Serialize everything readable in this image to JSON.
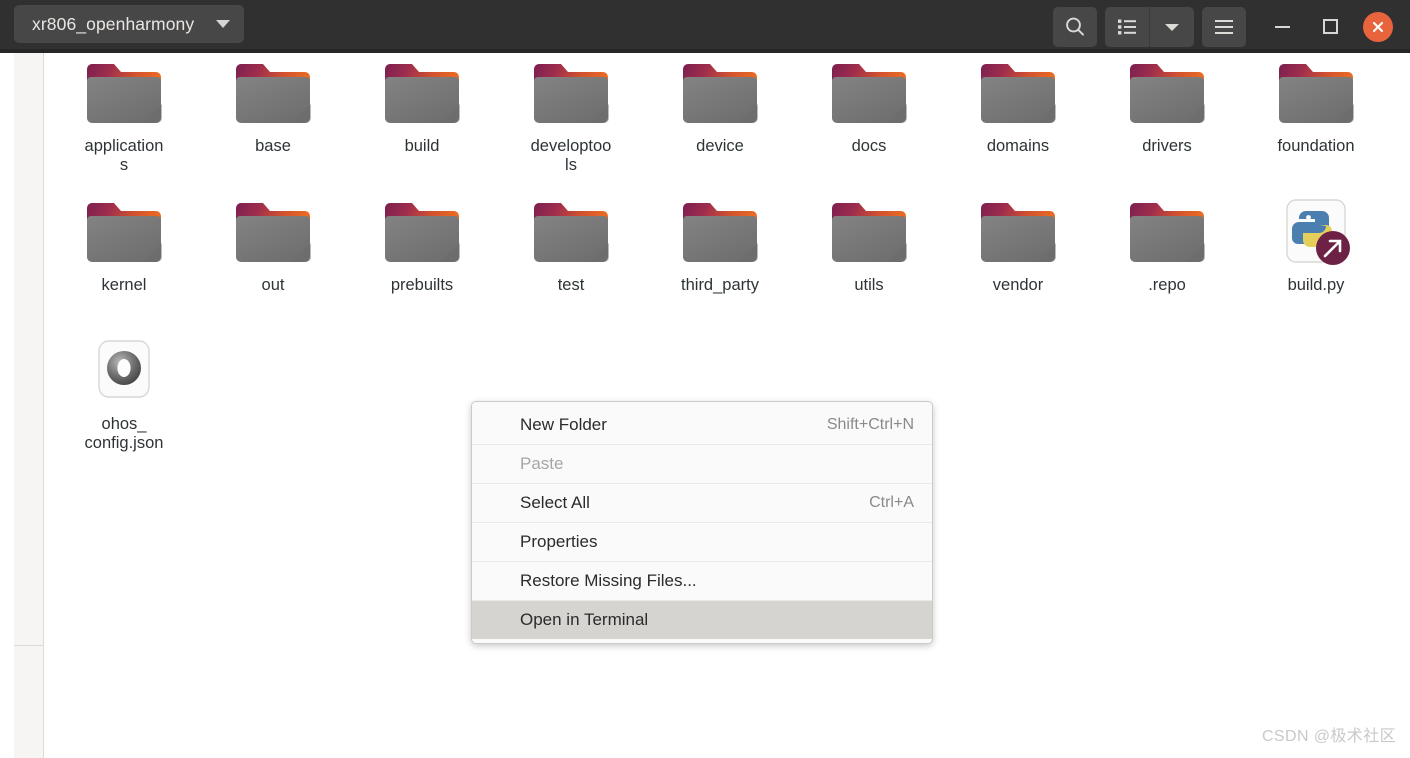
{
  "window": {
    "title": "xr806_openharmony",
    "accent_close": "#e8643c",
    "titlebar_bg": "#303030",
    "tab_bg": "#474747"
  },
  "titlebar": {
    "path_tab_label": "xr806_openharmony",
    "path_dropdown_icon": "chevron-down-icon",
    "search_icon": "search-icon",
    "list_view_icon": "list-view-icon",
    "view_dropdown_icon": "chevron-down-icon",
    "menu_icon": "hamburger-menu-icon",
    "minimize_icon": "minimize-icon",
    "maximize_icon": "maximize-icon",
    "close_icon": "close-icon"
  },
  "files": [
    {
      "name": "applications",
      "display": "application\ns",
      "type": "folder"
    },
    {
      "name": "base",
      "display": "base",
      "type": "folder"
    },
    {
      "name": "build",
      "display": "build",
      "type": "folder"
    },
    {
      "name": "developtools",
      "display": "developtoo\nls",
      "type": "folder"
    },
    {
      "name": "device",
      "display": "device",
      "type": "folder"
    },
    {
      "name": "docs",
      "display": "docs",
      "type": "folder"
    },
    {
      "name": "domains",
      "display": "domains",
      "type": "folder"
    },
    {
      "name": "drivers",
      "display": "drivers",
      "type": "folder"
    },
    {
      "name": "foundation",
      "display": "foundation",
      "type": "folder"
    },
    {
      "name": "kernel",
      "display": "kernel",
      "type": "folder"
    },
    {
      "name": "out",
      "display": "out",
      "type": "folder"
    },
    {
      "name": "prebuilts",
      "display": "prebuilts",
      "type": "folder"
    },
    {
      "name": "test",
      "display": "test",
      "type": "folder"
    },
    {
      "name": "third_party",
      "display": "third_party",
      "type": "folder"
    },
    {
      "name": "utils",
      "display": "utils",
      "type": "folder"
    },
    {
      "name": "vendor",
      "display": "vendor",
      "type": "folder"
    },
    {
      "name": ".repo",
      "display": ".repo",
      "type": "folder"
    },
    {
      "name": "build.py",
      "display": "build.py",
      "type": "python-script"
    },
    {
      "name": "ohos_config.json",
      "display": "ohos_\nconfig.json",
      "type": "json-file"
    }
  ],
  "context_menu": {
    "items": [
      {
        "label": "New Folder",
        "accel": "Shift+Ctrl+N",
        "disabled": false,
        "highlighted": false
      },
      {
        "label": "Paste",
        "accel": "",
        "disabled": true,
        "highlighted": false
      },
      {
        "label": "Select All",
        "accel": "Ctrl+A",
        "disabled": false,
        "highlighted": false
      },
      {
        "label": "Properties",
        "accel": "",
        "disabled": false,
        "highlighted": false
      },
      {
        "label": "Restore Missing Files...",
        "accel": "",
        "disabled": false,
        "highlighted": false
      },
      {
        "label": "Open in Terminal",
        "accel": "",
        "disabled": false,
        "highlighted": true
      }
    ]
  },
  "watermark": {
    "text": "CSDN @极术社区"
  }
}
